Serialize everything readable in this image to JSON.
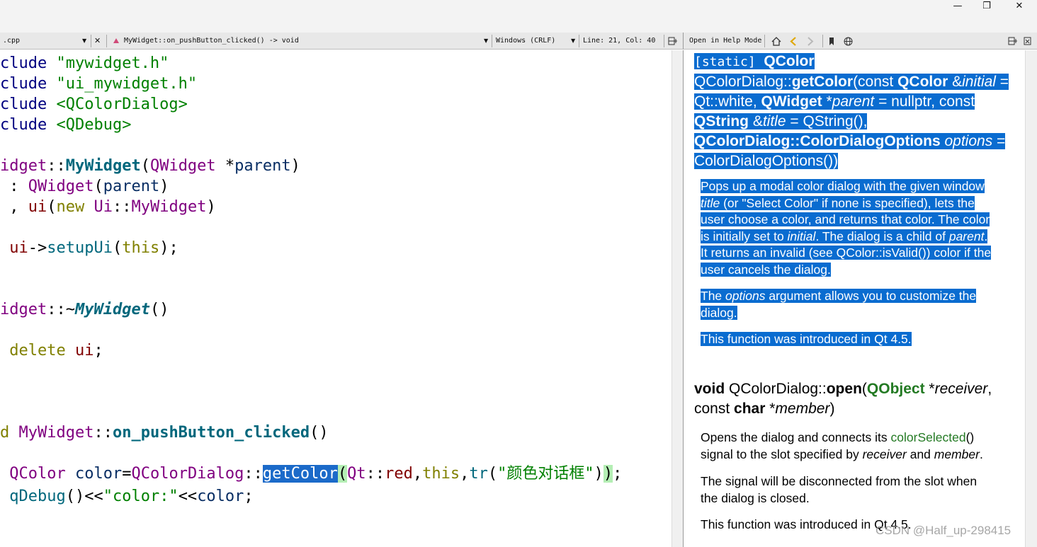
{
  "window": {
    "minimize": "—",
    "maximize": "❐",
    "close": "✕"
  },
  "toolbar": {
    "file_tab": ".cpp",
    "file_dropdown": "▼",
    "close_doc": "✕",
    "symbol": "MyWidget::on_pushButton_clicked() -> void",
    "symbol_dropdown": "▼",
    "line_endings": "Windows (CRLF)",
    "line_endings_dropdown": "▼",
    "cursor_pos": "Line: 21, Col: 40",
    "split_icon": "split-icon"
  },
  "help_toolbar": {
    "mode": "Open in Help Mode",
    "icons": [
      "home-icon",
      "back-icon",
      "forward-icon",
      "bookmark-icon",
      "globe-icon",
      "split-icon",
      "close-icon"
    ]
  },
  "code": {
    "l1_pp": "clude",
    "l1_str": " \"mywidget.h\"",
    "l2_pp": "clude",
    "l2_str": " \"ui_mywidget.h\"",
    "l3_pp": "clude",
    "l3_str": " <QColorDialog>",
    "l4_pp": "clude",
    "l4_str": " <QDebug>",
    "l5_a": "idget",
    "l5_b": "::",
    "l5_c": "MyWidget",
    "l5_d": "(",
    "l5_e": "QWidget",
    "l5_f": " *",
    "l5_g": "parent",
    "l5_h": ")",
    "l6_a": " : ",
    "l6_b": "QWidget",
    "l6_c": "(",
    "l6_d": "parent",
    "l6_e": ")",
    "l7_a": " , ",
    "l7_b": "ui",
    "l7_c": "(",
    "l7_d": "new",
    "l7_e": " ",
    "l7_f": "Ui",
    "l7_g": "::",
    "l7_h": "MyWidget",
    "l7_i": ")",
    "l8_a": " ",
    "l8_b": "ui",
    "l8_c": "->",
    "l8_d": "setupUi",
    "l8_e": "(",
    "l8_f": "this",
    "l8_g": ");",
    "l9_a": "idget",
    "l9_b": "::~",
    "l9_c": "MyWidget",
    "l9_d": "()",
    "l10_a": " ",
    "l10_b": "delete",
    "l10_c": " ",
    "l10_d": "ui",
    "l10_e": ";",
    "l11_a": "d",
    "l11_b": " ",
    "l11_c": "MyWidget",
    "l11_d": "::",
    "l11_e": "on_pushButton_clicked",
    "l11_f": "()",
    "l12_a": " ",
    "l12_b": "QColor",
    "l12_c": " ",
    "l12_d": "color",
    "l12_e": "=",
    "l12_f": "QColorDialog",
    "l12_g": "::",
    "l12_h": "getColor",
    "l12_i": "(",
    "l12_j": "Qt",
    "l12_k": "::",
    "l12_l": "red",
    "l12_m": ",",
    "l12_n": "this",
    "l12_o": ",",
    "l12_p": "tr",
    "l12_q": "(",
    "l12_r": "\"颜色对话框\"",
    "l12_s": ")",
    "l12_t": ")",
    "l12_u": ";",
    "l13_a": " ",
    "l13_b": "qDebug",
    "l13_c": "()<<",
    "l13_d": "\"color:\"",
    "l13_e": "<<",
    "l13_f": "color",
    "l13_g": ";"
  },
  "help": {
    "sig1": {
      "static": "[static]",
      "ret": "QColor",
      "cls": "QColorDialog::",
      "fn": "getColor",
      "p1a": "(const ",
      "p1b": "QColor",
      "p1c": " &",
      "p1d": "initial",
      "p1e": " =",
      "p2a": "Qt::white, ",
      "p2b": "QWidget",
      "p2c": " *",
      "p2d": "parent",
      "p2e": " = nullptr, const",
      "p3a": "QString",
      "p3b": " &",
      "p3c": "title",
      "p3d": " = QString(),",
      "p4a": "QColorDialog::ColorDialogOptions",
      "p4b": " ",
      "p4c": "options",
      "p4d": " =",
      "p5": "ColorDialogOptions())"
    },
    "para1": {
      "l1": "Pops up a modal color dialog with the given window",
      "l2a": "title",
      "l2b": " (or \"Select Color\" if none is specified), lets the",
      "l3": "user choose a color, and returns that color. The color",
      "l4a": "is initially set to ",
      "l4b": "initial",
      "l4c": ". The dialog is a child of ",
      "l4d": "parent",
      "l4e": ".",
      "l5": "It returns an invalid (see QColor::isValid()) color if the",
      "l6": "user cancels the dialog."
    },
    "para2": {
      "l1a": "The ",
      "l1b": "options",
      "l1c": " argument allows you to customize the",
      "l2": "dialog."
    },
    "para3": "This function was introduced in Qt 4.5.",
    "sig2": {
      "void": "void",
      "cls": " QColorDialog::",
      "fn": "open",
      "p1": "(",
      "obj": "QObject",
      "p2": " *",
      "recv": "receiver",
      "p3": ",",
      "const": "const ",
      "char": "char",
      "p4": " *",
      "member": "member",
      "p5": ")"
    },
    "para4": {
      "l1a": "Opens the dialog and connects its ",
      "l1b": "colorSelected",
      "l1c": "()",
      "l2a": "signal to the slot specified by ",
      "l2b": "receiver",
      "l2c": " and ",
      "l2d": "member",
      "l2e": "."
    },
    "para5": {
      "l1": "The signal will be disconnected from the slot when",
      "l2": "the dialog is closed."
    },
    "para6": "This function was introduced in Qt 4.5."
  },
  "watermark": "CSDN @Half_up-298415"
}
